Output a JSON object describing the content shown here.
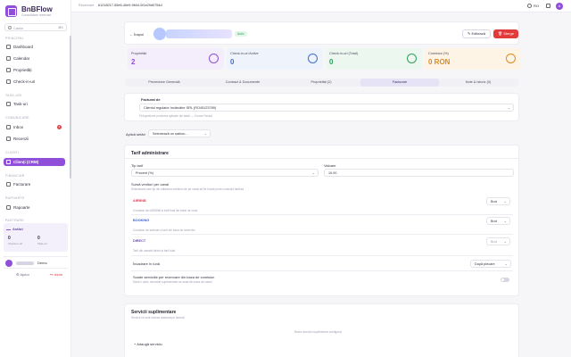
{
  "app": {
    "name": "BnBFlow",
    "subtitle": "Consolidare rezervari"
  },
  "search": {
    "placeholder": "Cauta",
    "shortcut": "⌘K"
  },
  "sidebar": {
    "sections": [
      "PRINCIPAL",
      "TASK-URI",
      "COMUNICARE",
      "CLIENTI",
      "FINANCIAR",
      "RAPOARTE",
      "PASTRARE"
    ],
    "items": [
      {
        "label": "Dashboard"
      },
      {
        "label": "Calendar"
      },
      {
        "label": "Proprietăți"
      },
      {
        "label": "Check-in-uri"
      },
      {
        "label": "Task-uri"
      },
      {
        "label": "Inbox",
        "badge": "3"
      },
      {
        "label": "Recenzii"
      },
      {
        "label": "Clienți (CRM)"
      },
      {
        "label": "Facturare"
      },
      {
        "label": "Rapoarte"
      }
    ],
    "activity": {
      "title": "Astăzi",
      "v1": "0",
      "l1": "Check-in-uri",
      "v2": "0",
      "l2": "Task-uri"
    },
    "user": {
      "name": "Demo"
    },
    "footer": {
      "settings": "Ajutor",
      "logout": "Ieșire"
    }
  },
  "topbar": {
    "label": "Rezervare",
    "id": "61218217-55e6-40e9-9b04-0f1e29d0754d",
    "lang": "RO",
    "avatar": "A"
  },
  "header": {
    "back": "Înapoi",
    "badge": "Activ",
    "edit": "Editează",
    "delete": "Șterge"
  },
  "stats": [
    {
      "label": "Proprietăți",
      "value": "2",
      "color": "#8f4fd9",
      "bg": "#f4eefc"
    },
    {
      "label": "Check-in-uri Active",
      "value": "0",
      "color": "#3b6fd8",
      "bg": "#eef3fc"
    },
    {
      "label": "Check-in-uri (Total)",
      "value": "0",
      "color": "#2f9e5c",
      "bg": "#ecf7f0"
    },
    {
      "label": "Comision (%)",
      "value": "0 RON",
      "color": "#e08a1a",
      "bg": "#fdf4e6"
    }
  ],
  "tabs": [
    "Prezentare Generală",
    "Contract & Documente",
    "Proprietăți (2)",
    "Facturare",
    "Note & Istoric (0)"
  ],
  "billing": {
    "facturat_label": "Facturat de",
    "facturat_value": "Clientul regulator încărcător SRL (RO45123789)",
    "facturat_hint": "Firă gestiune proforma aplicate din tabel — Creare Facturi",
    "aplica_label": "Aplică setări",
    "aplica_value": "Selectează un șablon..."
  },
  "tarif": {
    "title": "Tarif administrare",
    "tip_label": "Tip tarif",
    "tip_value": "Procent (%)",
    "valoare_label": "Valoare",
    "valoare_value": "10.00",
    "sursa_label": "Sursă venituri per canal",
    "sursa_hint": "Selectează care tip din utilizarea venitului de pe canal să fie folosit pentru calculul tarifului",
    "channels": [
      {
        "name": "AIRBNB",
        "hint": "Comision din AIRBNB și tarif final din tabel de zona",
        "value": "Brut",
        "color": "#e0405a"
      },
      {
        "name": "BOOKING",
        "hint": "Comision de selecție și tarif din baza de rezervări",
        "value": "Brut",
        "color": "#3b5fd0"
      },
      {
        "name": "DIRECT",
        "hint": "Tarif din canalul direct și tarif total",
        "value": "Brut",
        "color": "#6a4bb0"
      }
    ],
    "rotunjire_label": "Încadrare în lună",
    "rotunjire_value": "După plecare",
    "scade_label": "Scade serviciile per rezervare din baza de comision",
    "scade_hint": "Dacă e activ, serviciile suplimentare se scad din baza de calcul"
  },
  "servicii": {
    "title": "Servicii suplimentare",
    "hint": "Servicii ce sunt incluse automat pe factură",
    "empty": "Niciun serviciu suplimentar configurat",
    "add": "Adaugă serviciu"
  }
}
